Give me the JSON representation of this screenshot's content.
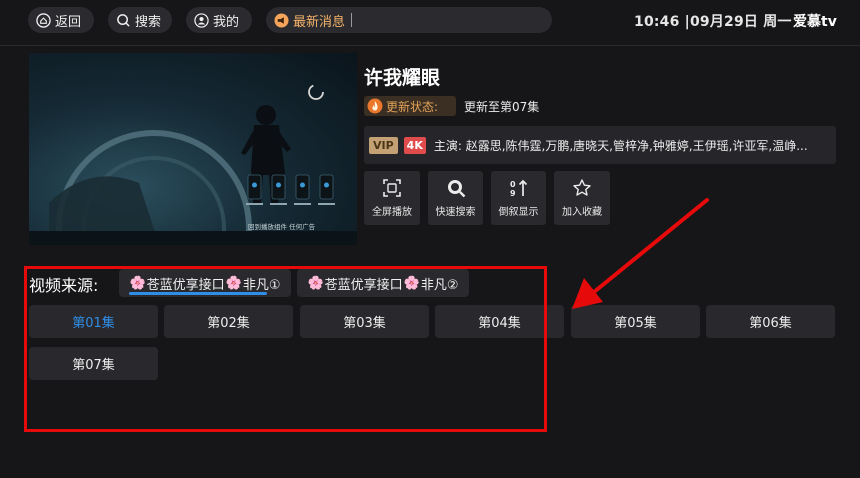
{
  "topbar": {
    "back_label": "返回",
    "search_label": "搜索",
    "mine_label": "我的",
    "news_label": "最新消息",
    "datetime": "10:46 |09月29日 周一",
    "brand": "爱慕tv"
  },
  "video": {
    "title": "许我耀眼",
    "status_tag": "更新状态:",
    "status_value": "更新至第07集",
    "badge_vip": "VIP",
    "badge_4k": "4K",
    "cast": "主演:  赵露思,陈伟霆,万鹏,唐晓天,管梓净,钟雅婷,王伊瑶,许亚军,温峥...",
    "thumb_overlay_text": "回到播放组件 任何广告"
  },
  "actions": [
    {
      "label": "全屏播放",
      "icon": "fullscreen-icon"
    },
    {
      "label": "快速搜索",
      "icon": "search-icon"
    },
    {
      "label": "倒叙显示",
      "icon": "sort-reverse-icon"
    },
    {
      "label": "加入收藏",
      "icon": "star-icon"
    }
  ],
  "sources": {
    "label": "视频来源:",
    "items": [
      {
        "prefix": "🌸",
        "name": "苍蓝优享接口",
        "mid": "🌸",
        "suffix": "非凡①",
        "selected": true
      },
      {
        "prefix": "🌸",
        "name": "苍蓝优享接口",
        "mid": "🌸",
        "suffix": "非凡②",
        "selected": false
      }
    ]
  },
  "episodes": {
    "items": [
      "第01集",
      "第02集",
      "第03集",
      "第04集",
      "第05集",
      "第06集",
      "第07集"
    ],
    "active_index": 0
  },
  "colors": {
    "background": "#161618",
    "accent": "#2f8ee8",
    "annotation": "#e60a0a",
    "status_tag": "#e2a35a"
  }
}
